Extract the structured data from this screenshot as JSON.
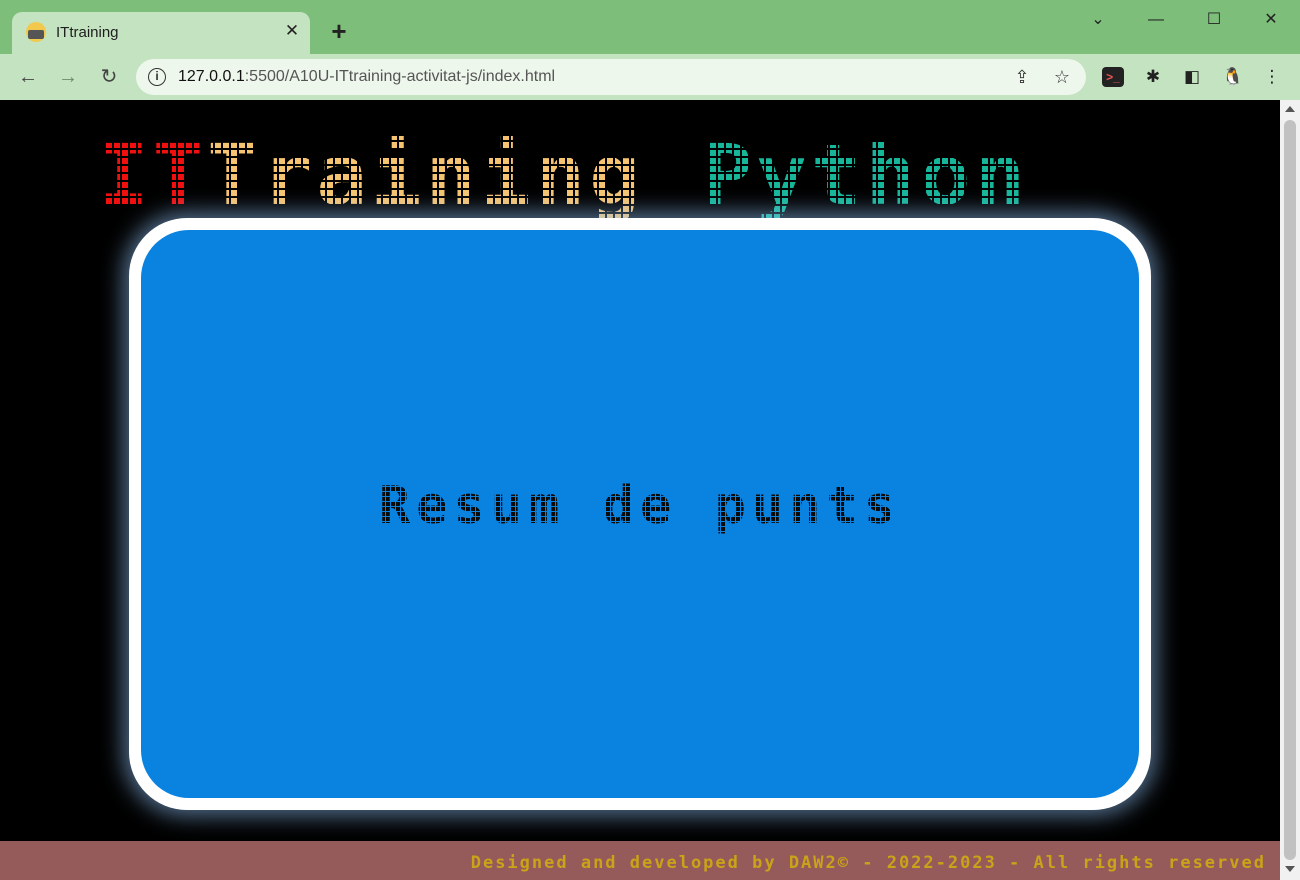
{
  "browser": {
    "tab": {
      "title": "ITtraining",
      "close_glyph": "✕"
    },
    "new_tab_glyph": "+",
    "window_controls": {
      "tablist": "⌄",
      "minimize": "—",
      "maximize": "☐",
      "close": "✕"
    },
    "nav": {
      "back": "←",
      "forward": "→",
      "reload": "↻"
    },
    "address": {
      "host": "127.0.0.1",
      "rest": ":5500/A10U-ITtraining-activitat-js/index.html"
    },
    "icons": {
      "info": "i",
      "share": "⇪",
      "bookmark": "☆",
      "terminal": ">_",
      "extensions": "✱",
      "sidepanel": "◧",
      "profile": "🐧",
      "menu": "⋮"
    }
  },
  "page": {
    "logo": {
      "part1": "IT",
      "part2": "Training",
      "part3": "Python"
    },
    "card_title": "Resum de punts",
    "footer": "Designed and developed by DAW2© - 2022-2023 - All rights reserved"
  },
  "colors": {
    "chrome_frame": "#7dbe7a",
    "chrome_toolbar": "#c4e3c0",
    "logo_it": "#f01010",
    "logo_training": "#f6c470",
    "logo_python": "#17b69a",
    "card_fill": "#0a82e0",
    "footer_bg": "#955b5b",
    "footer_text": "#c9a318"
  }
}
